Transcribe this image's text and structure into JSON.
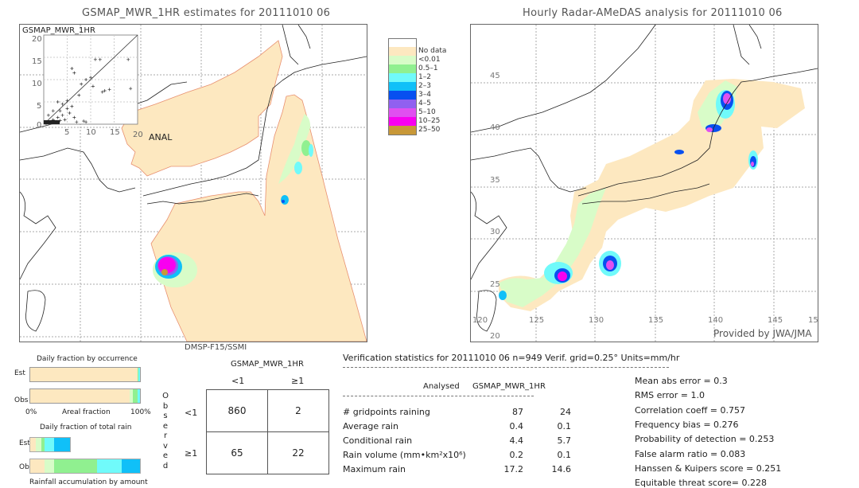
{
  "chart_data": [
    {
      "type": "heatmap",
      "id": "gsmap-map",
      "title": "GSMAP_MWR_1HR estimates for 20111010 06",
      "footer": "DMSP-F15/SSMI",
      "inset": {
        "type": "scatter",
        "title": "GSMAP_MWR_1HR",
        "xlabel": "ANAL",
        "xlim": [
          0,
          20
        ],
        "ylim": [
          0,
          20
        ],
        "xticks": [
          "0",
          "5",
          "10",
          "15",
          "20"
        ],
        "yticks": [
          "0",
          "5",
          "10",
          "15",
          "20"
        ],
        "points": [
          [
            0.5,
            0.2
          ],
          [
            1,
            0.5
          ],
          [
            1.5,
            0.3
          ],
          [
            2,
            1
          ],
          [
            2.5,
            0.4
          ],
          [
            3,
            1.5
          ],
          [
            3.5,
            0.8
          ],
          [
            4,
            2
          ],
          [
            4.5,
            1
          ],
          [
            5,
            3.5
          ],
          [
            5.5,
            2.5
          ],
          [
            6,
            4
          ],
          [
            6.5,
            1.5
          ],
          [
            7,
            0.5
          ],
          [
            7.5,
            6.5
          ],
          [
            8,
            9
          ],
          [
            9,
            10
          ],
          [
            10,
            10.5
          ],
          [
            11,
            14.5
          ],
          [
            12,
            14.5
          ],
          [
            13,
            7.5
          ],
          [
            14,
            7.8
          ],
          [
            18,
            14.5
          ],
          [
            18.5,
            8
          ],
          [
            6,
            12.5
          ],
          [
            6.5,
            11.5
          ],
          [
            3,
            5
          ],
          [
            2,
            3
          ],
          [
            8.5,
            0.7
          ],
          [
            9,
            0.5
          ],
          [
            1,
            2
          ],
          [
            3.5,
            3
          ],
          [
            4,
            4.5
          ],
          [
            5,
            5.3
          ],
          [
            10.5,
            8.5
          ],
          [
            12.5,
            7.2
          ]
        ]
      },
      "legend": {
        "entries": [
          {
            "label": "",
            "color": "#ffffff"
          },
          {
            "label": "No data",
            "color": "#fde8c0"
          },
          {
            "label": "<0.01",
            "color": "#d8fcc8"
          },
          {
            "label": "0.5–1",
            "color": "#90f090"
          },
          {
            "label": "1–2",
            "color": "#70fafa"
          },
          {
            "label": "2–3",
            "color": "#10c0f8"
          },
          {
            "label": "3–4",
            "color": "#0850f0"
          },
          {
            "label": "4–5",
            "color": "#9060f0"
          },
          {
            "label": "5–10",
            "color": "#e050f0"
          },
          {
            "label": "10–25",
            "color": "#f800f0"
          },
          {
            "label": "25–50",
            "color": "#c89838"
          }
        ]
      }
    },
    {
      "type": "heatmap",
      "id": "radar-map",
      "title": "Hourly Radar-AMeDAS analysis for 20111010 06",
      "credit": "Provided by JWA/JMA",
      "xticks": [
        "120",
        "125",
        "130",
        "135",
        "140",
        "145",
        "15"
      ],
      "yticks": [
        "45",
        "40",
        "35",
        "30",
        "25",
        "20"
      ],
      "xlim": [
        120,
        150
      ],
      "ylim": [
        20,
        50
      ]
    },
    {
      "type": "bar",
      "id": "occurrence-fraction",
      "title": "Daily fraction by occurrence",
      "xlabel": "Areal fraction",
      "xtick_left": "0%",
      "xtick_right": "100%",
      "categories": [
        "Est",
        "Obs"
      ],
      "series": [
        {
          "name": "Est",
          "values": [
            {
              "color": "#fde8c0",
              "frac": 0.975
            },
            {
              "color": "#90f090",
              "frac": 0.008
            },
            {
              "color": "#70fafa",
              "frac": 0.017
            }
          ]
        },
        {
          "name": "Obs",
          "values": [
            {
              "color": "#fde8c0",
              "frac": 0.905
            },
            {
              "color": "#d8fcc8",
              "frac": 0.03
            },
            {
              "color": "#90f090",
              "frac": 0.045
            },
            {
              "color": "#70fafa",
              "frac": 0.02
            }
          ]
        }
      ]
    },
    {
      "type": "bar",
      "id": "total-rain-fraction",
      "title": "Daily fraction of total rain",
      "xlabel": "Rainfall accumulation by amount",
      "categories": [
        "Est",
        "Obs"
      ],
      "series": [
        {
          "name": "Est",
          "scale": 0.36,
          "values": [
            {
              "color": "#fde8c0",
              "frac": 0.15
            },
            {
              "color": "#d8fcc8",
              "frac": 0.13
            },
            {
              "color": "#90f090",
              "frac": 0.08
            },
            {
              "color": "#70fafa",
              "frac": 0.24
            },
            {
              "color": "#10c0f8",
              "frac": 0.4
            }
          ]
        },
        {
          "name": "Obs",
          "scale": 1.0,
          "values": [
            {
              "color": "#fde8c0",
              "frac": 0.13
            },
            {
              "color": "#d8fcc8",
              "frac": 0.09
            },
            {
              "color": "#90f090",
              "frac": 0.39
            },
            {
              "color": "#70fafa",
              "frac": 0.22
            },
            {
              "color": "#10c0f8",
              "frac": 0.17
            }
          ]
        }
      ]
    },
    {
      "type": "table",
      "id": "contingency-table",
      "col_header": "GSMAP_MWR_1HR",
      "row_header": "Observed",
      "col_labels": [
        "<1",
        "≥1"
      ],
      "row_labels": [
        "<1",
        "≥1"
      ],
      "cells": [
        [
          860,
          2
        ],
        [
          65,
          22
        ]
      ]
    }
  ],
  "stats": {
    "header": "Verification statistics for 20111010 06   n=949   Verif. grid=0.25°   Units=mm/hr",
    "col_analysed": "Analysed",
    "col_est": "GSMAP_MWR_1HR",
    "rows": [
      {
        "label": "# gridpoints raining",
        "analysed": "87",
        "est": "24"
      },
      {
        "label": "Average rain",
        "analysed": "0.4",
        "est": "0.1"
      },
      {
        "label": "Conditional rain",
        "analysed": "4.4",
        "est": "5.7"
      },
      {
        "label": "Rain volume (mm•km²x10⁶)",
        "analysed": "0.2",
        "est": "0.1"
      },
      {
        "label": "Maximum rain",
        "analysed": "17.2",
        "est": "14.6"
      }
    ],
    "scores": [
      "Mean abs error = 0.3",
      "RMS error = 1.0",
      "Correlation coeff = 0.757",
      "Frequency bias = 0.276",
      "Probability of detection = 0.253",
      "False alarm ratio = 0.083",
      "Hanssen & Kuipers score = 0.251",
      "Equitable threat score= 0.228"
    ]
  }
}
